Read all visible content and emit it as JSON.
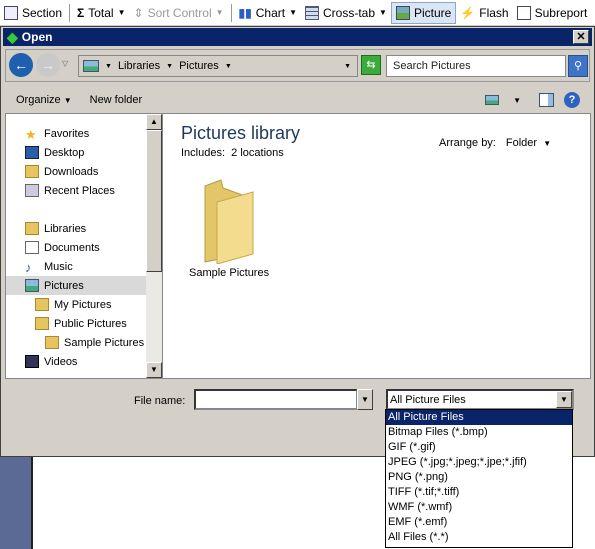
{
  "toolbar": {
    "items": [
      {
        "label": "Section",
        "icon": "section-icon"
      },
      {
        "label": "Total",
        "icon": "sigma-icon",
        "dropdown": true
      },
      {
        "label": "Sort Control",
        "icon": "sort-icon",
        "dropdown": true,
        "disabled": true
      },
      {
        "label": "Chart",
        "icon": "chart-icon",
        "dropdown": true
      },
      {
        "label": "Cross-tab",
        "icon": "crosstab-icon",
        "dropdown": true
      },
      {
        "label": "Picture",
        "icon": "picture-icon",
        "active": true
      },
      {
        "label": "Flash",
        "icon": "flash-icon"
      },
      {
        "label": "Subreport",
        "icon": "subreport-icon"
      }
    ]
  },
  "dialog": {
    "title": "Open",
    "close": "✕",
    "address": {
      "crumbs": [
        "Libraries",
        "Pictures"
      ]
    },
    "search": {
      "placeholder": "Search Pictures"
    },
    "commands": {
      "organize": "Organize",
      "new_folder": "New folder"
    },
    "nav": [
      {
        "label": "Favorites",
        "icon": "star-icon",
        "indent": 0
      },
      {
        "label": "Desktop",
        "icon": "desktop-icon",
        "indent": 1
      },
      {
        "label": "Downloads",
        "icon": "downloads-icon",
        "indent": 1
      },
      {
        "label": "Recent Places",
        "icon": "recent-places-icon",
        "indent": 1
      },
      {
        "label": "Libraries",
        "icon": "libraries-icon",
        "indent": 0
      },
      {
        "label": "Documents",
        "icon": "documents-icon",
        "indent": 1
      },
      {
        "label": "Music",
        "icon": "music-icon",
        "indent": 1
      },
      {
        "label": "Pictures",
        "icon": "pictures-icon",
        "indent": 1,
        "selected": true
      },
      {
        "label": "My Pictures",
        "icon": "folder-icon",
        "indent": 2
      },
      {
        "label": "Public Pictures",
        "icon": "folder-icon",
        "indent": 2
      },
      {
        "label": "Sample Pictures",
        "icon": "folder-icon",
        "indent": 3
      },
      {
        "label": "Videos",
        "icon": "videos-icon",
        "indent": 1
      }
    ],
    "content": {
      "title": "Pictures library",
      "includes_label": "Includes:",
      "includes_link": "2 locations",
      "arrange_label": "Arrange by:",
      "arrange_value": "Folder",
      "items": [
        {
          "label": "Sample Pictures",
          "icon": "folder-icon"
        }
      ]
    },
    "file_name_label": "File name:",
    "file_name_value": "",
    "filter": {
      "selected": "All Picture Files",
      "options": [
        "All Picture Files",
        "Bitmap Files (*.bmp)",
        "GIF (*.gif)",
        "JPEG (*.jpg;*.jpeg;*.jpe;*.jfif)",
        "PNG (*.png)",
        "TIFF (*.tif;*.tiff)",
        "WMF (*.wmf)",
        "EMF (*.emf)",
        "All Files (*.*)"
      ]
    }
  },
  "colors": {
    "titlebar": "#0a246a",
    "selection": "#0a246a",
    "dialog_bg": "#d4d0c8"
  }
}
